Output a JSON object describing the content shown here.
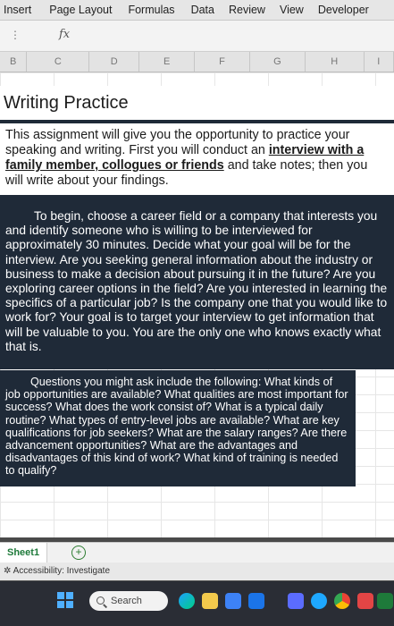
{
  "ribbon": {
    "tabs": [
      "Insert",
      "Page Layout",
      "Formulas",
      "Data",
      "Review",
      "View",
      "Developer"
    ]
  },
  "formula_bar": {
    "fx": "fx",
    "dots": "⋮"
  },
  "columns": [
    "B",
    "C",
    "D",
    "E",
    "F",
    "G",
    "H",
    "I"
  ],
  "document": {
    "title": "Writing Practice",
    "intro_part1": "This assignment will give you the opportunity to practice your speaking and writing. First you will conduct an ",
    "intro_link": "interview with a family member, collogues or friends",
    "intro_part2": " and take notes; then you will write about your findings.",
    "paragraph2": "To begin, choose a career field or a company that interests you and identify someone who is willing to be interviewed for approximately 30 minutes. Decide what your goal will be for the interview. Are you seeking general information about the industry or business to make a decision about pursuing it in the future? Are you exploring career options in the field? Are you interested in learning the specifics of a particular job? Is the company one that you would like to work for? Your goal is to target your interview to get information that will be valuable to you. You are the only one who knows exactly what that is.",
    "questions": "Questions you might ask include the following: What kinds of job opportunities are available? What qualities are most important for success? What does the work consist of? What is a typical daily routine? What types of entry-level jobs are available? What are key qualifications for job seekers? What are the salary ranges? Are there advancement opportunities? What are the advantages and disadvantages of this kind of work? What kind of training is needed to qualify?"
  },
  "sheet_tabs": {
    "sheet1": "Sheet1",
    "add": "+"
  },
  "status_bar": {
    "accessibility": "Accessibility: Investigate"
  },
  "taskbar": {
    "search_label": "Search"
  },
  "colors": {
    "doc_bg": "#1f2a38",
    "sheet_green": "#1e7a3a",
    "taskbar": "#2a2d35"
  }
}
